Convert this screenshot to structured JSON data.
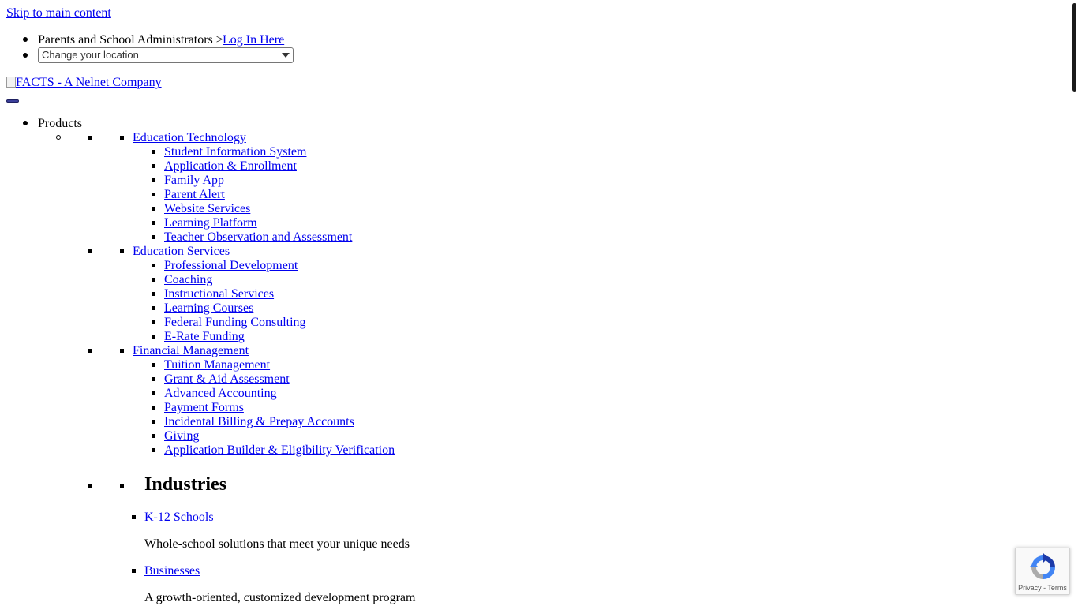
{
  "skip_link": "Skip to main content",
  "utility": {
    "parents_label": "Parents and School Administrators >",
    "login_link": "Log In Here",
    "location_select": "Change your location"
  },
  "logo_alt": "FACTS - A Nelnet Company",
  "nav": {
    "products_label": "Products",
    "groups": [
      {
        "label": "Education Technology",
        "items": [
          "Student Information System",
          "Application & Enrollment",
          "Family App",
          "Parent Alert",
          "Website Services",
          "Learning Platform",
          "Teacher Observation and Assessment"
        ]
      },
      {
        "label": "Education Services",
        "items": [
          "Professional Development",
          "Coaching",
          "Instructional Services",
          "Learning Courses",
          "Federal Funding Consulting",
          "E-Rate Funding"
        ]
      },
      {
        "label": "Financial Management",
        "items": [
          "Tuition Management",
          "Grant & Aid Assessment",
          "Advanced Accounting",
          "Payment Forms",
          "Incidental Billing & Prepay Accounts",
          "Giving",
          "Application Builder & Eligibility Verification"
        ]
      }
    ],
    "industries": {
      "heading": "Industries",
      "items": [
        {
          "label": "K-12 Schools",
          "desc": "Whole-school solutions that meet your unique needs"
        },
        {
          "label": "Businesses",
          "desc": "A growth-oriented, customized development program"
        }
      ]
    }
  },
  "recaptcha": {
    "footer": "Privacy - Terms"
  },
  "colors": {
    "link": "#0000ee",
    "toggle": "#3b3f9a"
  }
}
